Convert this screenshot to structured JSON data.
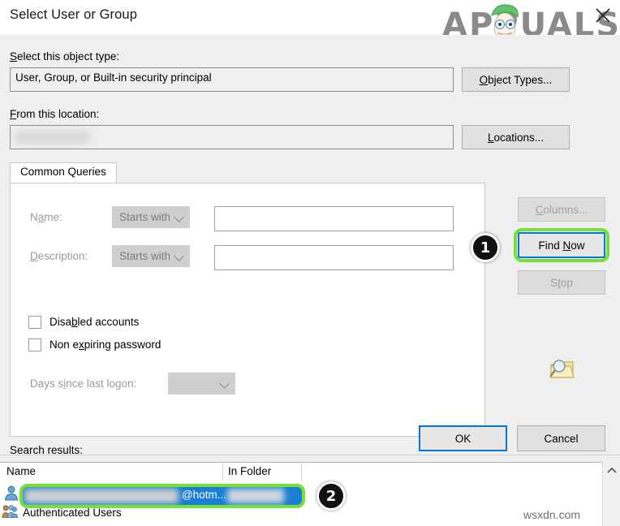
{
  "window": {
    "title": "Select User or Group",
    "close_icon": "close-icon"
  },
  "watermark": {
    "logo_text": "APPUALS",
    "site": "wsxdn.com"
  },
  "object_type": {
    "label": "Select this object type:",
    "label_accesskey": "S",
    "value": "User, Group, or Built-in security principal",
    "button": "Object Types...",
    "button_accesskey": "O"
  },
  "location": {
    "label": "From this location:",
    "label_accesskey": "F",
    "value": "",
    "redacted": true,
    "button": "Locations...",
    "button_accesskey": "L"
  },
  "tabs": [
    {
      "label": "Common Queries",
      "selected": true
    }
  ],
  "queries": {
    "name": {
      "label": "Name:",
      "label_accesskey": "a",
      "operator": "Starts with",
      "value": "",
      "disabled": true
    },
    "description": {
      "label": "Description:",
      "label_accesskey": "D",
      "operator": "Starts with",
      "value": "",
      "disabled": true
    },
    "disabled_accounts": {
      "label": "Disabled accounts",
      "label_accesskey": "b",
      "checked": false
    },
    "non_expiring_password": {
      "label": "Non expiring password",
      "label_accesskey": "x",
      "checked": false
    },
    "days_since_logon": {
      "label": "Days since last logon:",
      "label_accesskey": "i",
      "value": "",
      "disabled": true
    }
  },
  "actions": {
    "columns": {
      "label": "Columns...",
      "accesskey": "C",
      "disabled": true
    },
    "find_now": {
      "label": "Find Now",
      "accesskey": "N",
      "disabled": false,
      "focused": true
    },
    "stop": {
      "label": "Stop",
      "accesskey": "t",
      "disabled": true
    },
    "search_icon": "search-folder-icon"
  },
  "dialog_buttons": {
    "ok": {
      "label": "OK",
      "default": true
    },
    "cancel": {
      "label": "Cancel",
      "default": false
    }
  },
  "search_results": {
    "label": "Search results:",
    "label_accesskey": "l",
    "columns": [
      "Name",
      "In Folder"
    ],
    "rows": [
      {
        "name": "@hotm...",
        "in_folder": "",
        "icon": "user-icon",
        "selected": true,
        "redacted": true
      },
      {
        "name": "Authenticated Users",
        "in_folder": "",
        "icon": "group-icon",
        "selected": false,
        "redacted": false
      }
    ],
    "scroll_up_icon": "chevron-up-icon"
  },
  "annotations": [
    {
      "number": "1",
      "target": "find-now-button"
    },
    {
      "number": "2",
      "target": "selected-result-row"
    }
  ],
  "colors": {
    "highlight_green": "#76e034",
    "focus_blue": "#0078d7",
    "selection_blue": "#1a7fd4",
    "badge_black": "#111111",
    "surface": "#efefef"
  }
}
